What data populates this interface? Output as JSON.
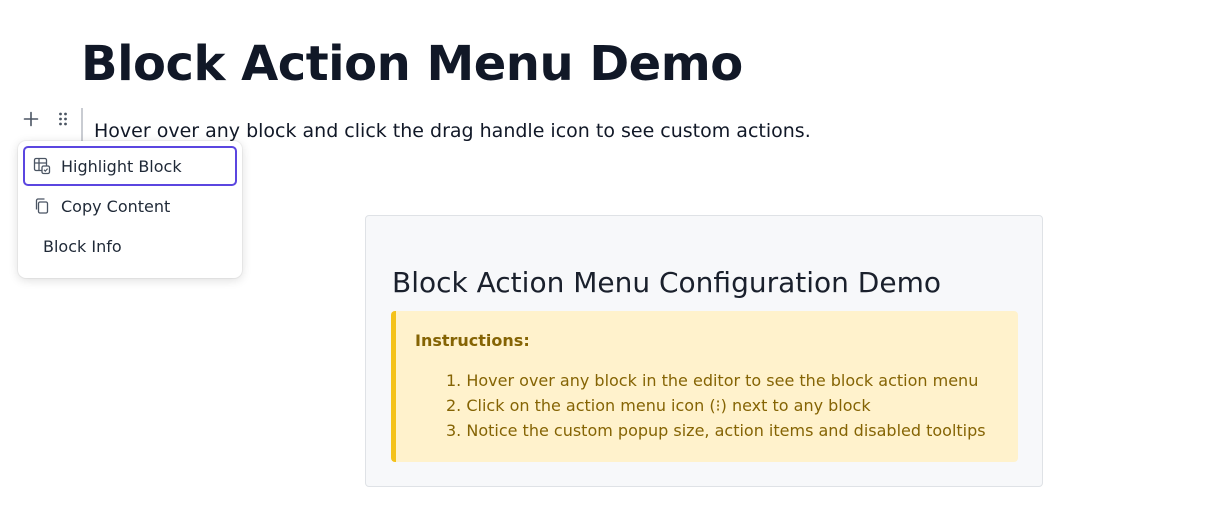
{
  "page": {
    "title": "Block Action Menu Demo"
  },
  "block_controls": {
    "add_icon": "plus-icon",
    "drag_icon": "drag-handle-icon"
  },
  "editor": {
    "paragraph": "Hover over any block and click the drag handle icon to see custom actions."
  },
  "action_menu": {
    "items": [
      {
        "label": "Highlight Block",
        "icon": "highlight-block-icon",
        "active": true
      },
      {
        "label": "Copy Content",
        "icon": "copy-icon",
        "active": false
      },
      {
        "label": "Block Info",
        "icon": "",
        "active": false
      }
    ],
    "accent_color": "#5b46e0"
  },
  "config_card": {
    "title": "Block Action Menu Configuration Demo",
    "instructions": {
      "heading": "Instructions:",
      "steps": [
        "1. Hover over any block in the editor to see the block action menu",
        "2. Click on the action menu icon (⁝) next to any block",
        "3. Notice the custom popup size, action items and disabled tooltips"
      ],
      "background_color": "#fff2cc",
      "border_color": "#f4c21a",
      "text_color": "#856404"
    }
  }
}
